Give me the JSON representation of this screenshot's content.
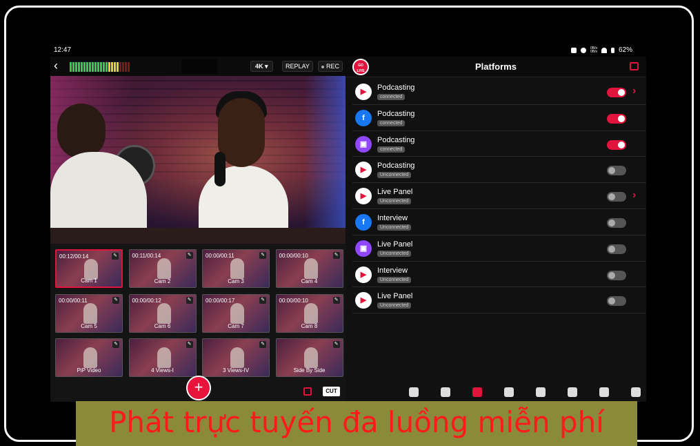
{
  "status": {
    "time": "12:47",
    "battery": "62%",
    "speed_top": "0B/s",
    "speed_bottom": "0B/s"
  },
  "toolbar": {
    "resolution": "4K ▾",
    "replay": "REPLAY",
    "rec": "REC",
    "back": "‹"
  },
  "cams": [
    {
      "time": "00:12/00:14",
      "label": "Cam 1",
      "active": true
    },
    {
      "time": "00:11/00:14",
      "label": "Cam 2"
    },
    {
      "time": "00:00/00:11",
      "label": "Cam 3"
    },
    {
      "time": "00:00/00:10",
      "label": "Cam 4"
    },
    {
      "time": "00:00/00:11",
      "label": "Cam 5"
    },
    {
      "time": "00:00/00:12",
      "label": "Cam 6"
    },
    {
      "time": "00:00/00:17",
      "label": "Cam 7"
    },
    {
      "time": "00:00/00:10",
      "label": "Cam 8"
    },
    {
      "time": "",
      "label": "PiP Video"
    },
    {
      "time": "",
      "label": "4 Views-I"
    },
    {
      "time": "",
      "label": "3 Views-IV"
    },
    {
      "time": "",
      "label": "Side By Side"
    }
  ],
  "fab_label": "+",
  "cut_label": "CUT",
  "panel": {
    "title": "Platforms",
    "golive": "GO LIVE"
  },
  "platforms": [
    {
      "name": "Podcasting",
      "status": "connected",
      "platform": "youtube",
      "on": true,
      "chevron": true
    },
    {
      "name": "Podcasting",
      "status": "connected",
      "platform": "facebook",
      "on": true
    },
    {
      "name": "Podcasting",
      "status": "connected",
      "platform": "twitch",
      "on": true
    },
    {
      "name": "Podcasting",
      "status": "Unconnected",
      "platform": "custom",
      "on": false
    },
    {
      "name": "Live Panel",
      "status": "Unconnected",
      "platform": "youtube",
      "on": false,
      "chevron": true
    },
    {
      "name": "Interview",
      "status": "Unconnected",
      "platform": "facebook",
      "on": false
    },
    {
      "name": "Live Panel",
      "status": "Unconnected",
      "platform": "twitch",
      "on": false
    },
    {
      "name": "Interview",
      "status": "Unconnected",
      "platform": "custom",
      "on": false
    },
    {
      "name": "Live Panel",
      "status": "Unconnected",
      "platform": "custom",
      "on": false
    }
  ],
  "platform_colors": {
    "youtube": "#ffffff",
    "facebook": "#1877f2",
    "twitch": "#9146ff",
    "custom": "#ffffff"
  },
  "platform_glyphs": {
    "youtube": "▶",
    "facebook": "f",
    "twitch": "▣",
    "custom": "▶"
  },
  "bottom_icons": [
    "switcher-icon",
    "layers-icon",
    "share-icon",
    "guests-icon",
    "audio-icon",
    "aspect-ratio-icon",
    "captions-icon",
    "comments-icon",
    "camera-switch-icon"
  ],
  "caption": "Phát trực tuyến đa luồng miễn phí",
  "accent": "#e0143c"
}
